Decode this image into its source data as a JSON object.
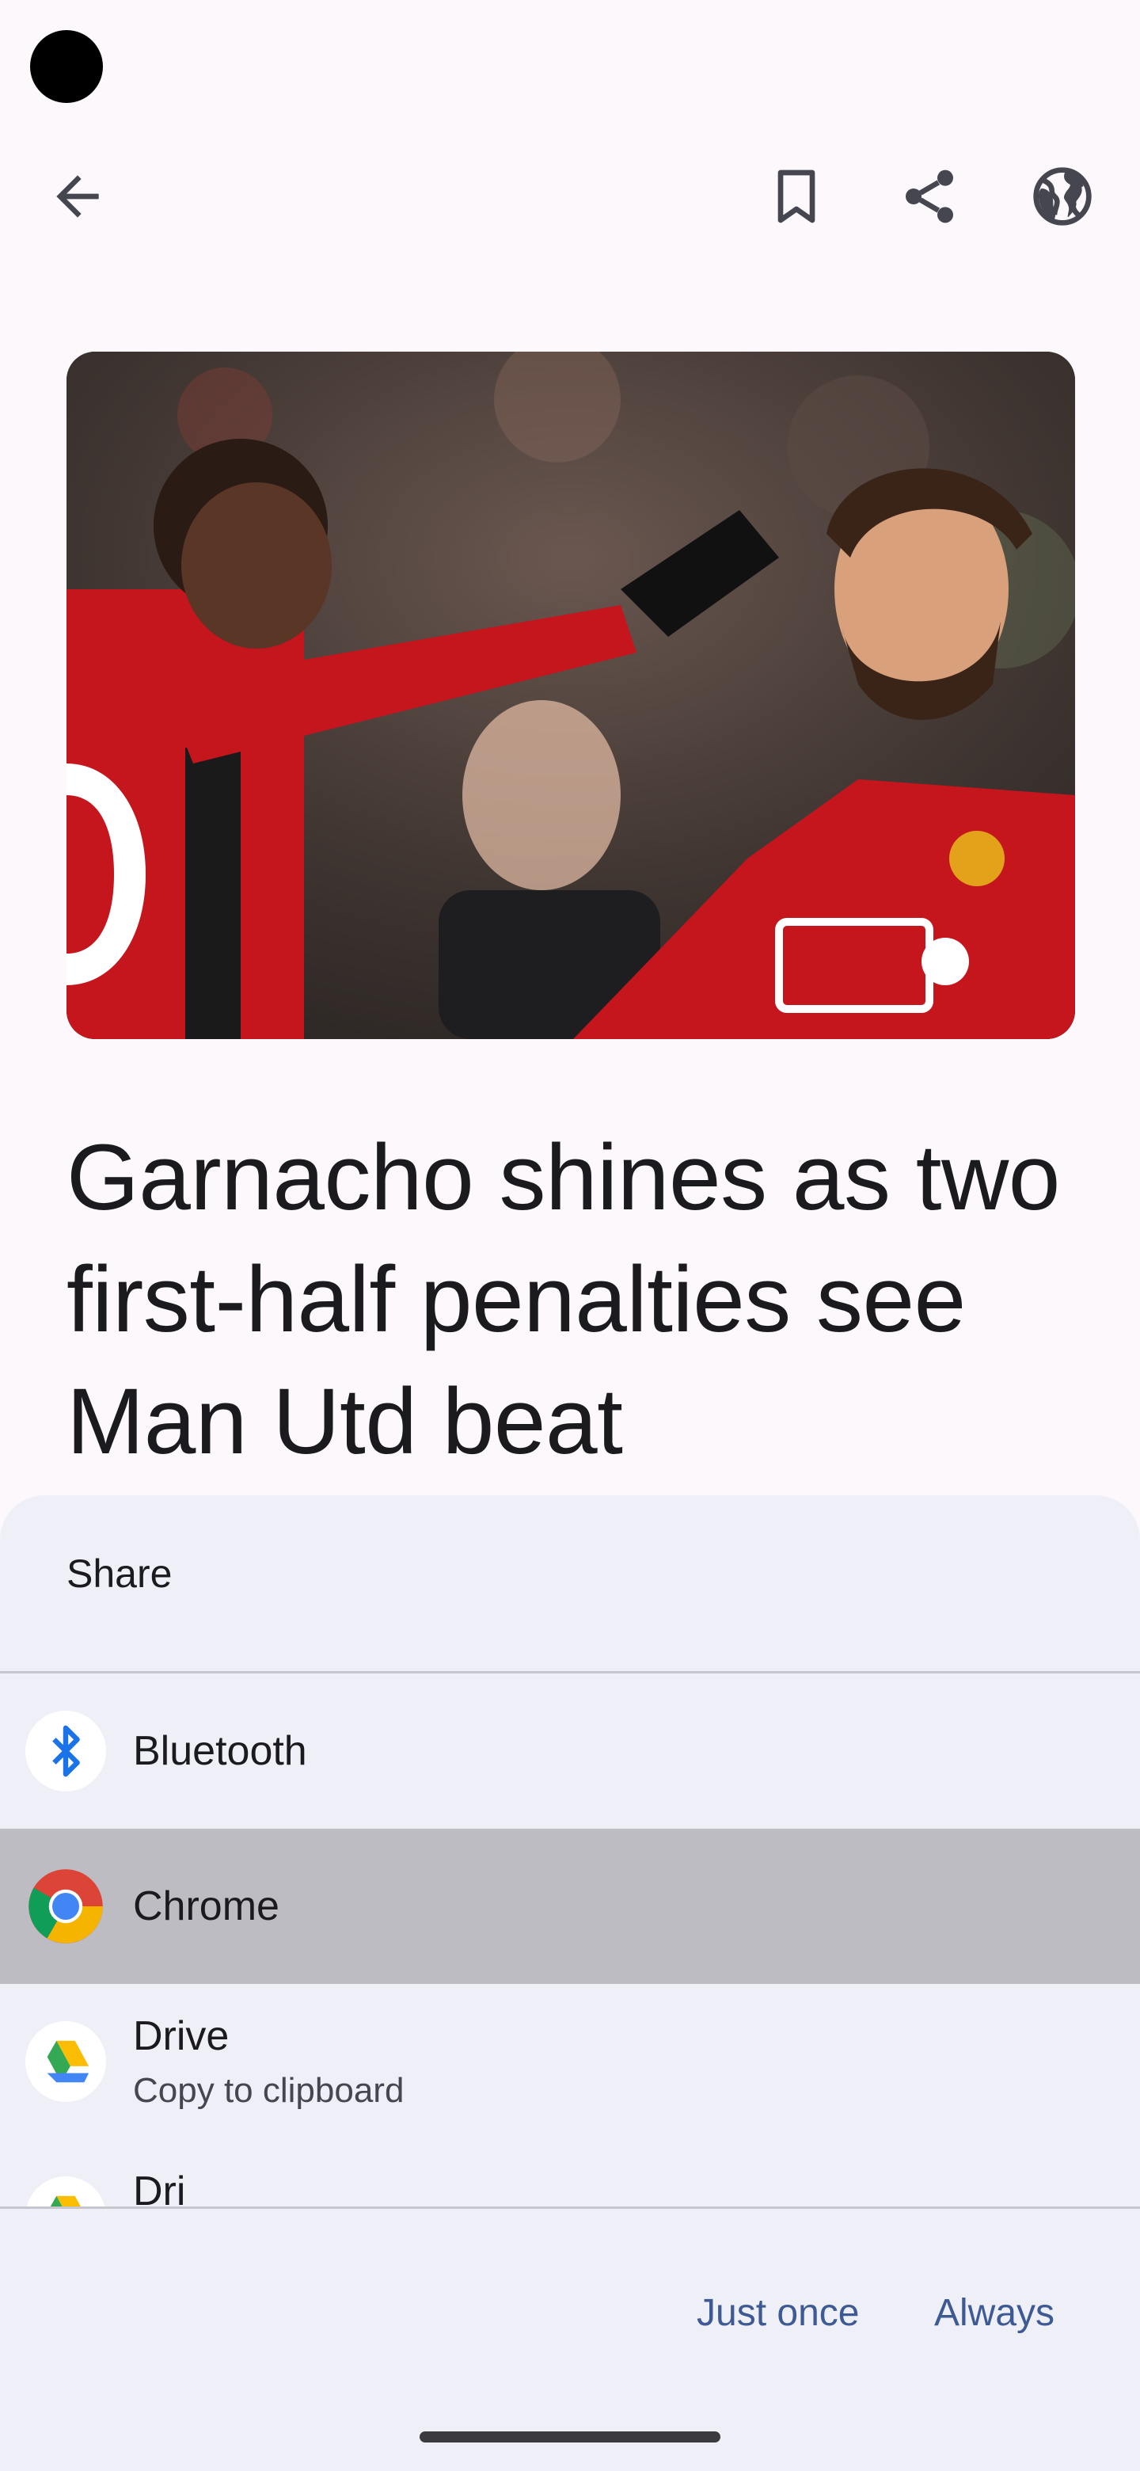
{
  "header": {
    "back_icon": "arrow-left-icon",
    "bookmark_icon": "bookmark-icon",
    "share_icon": "share-icon",
    "globe_icon": "globe-icon"
  },
  "article": {
    "headline": "Garnacho shines as two first-half penalties see Man Utd beat"
  },
  "share_sheet": {
    "title": "Share",
    "items": [
      {
        "label": "Bluetooth",
        "sublabel": "",
        "icon": "bluetooth-icon"
      },
      {
        "label": "Chrome",
        "sublabel": "",
        "icon": "chrome-icon",
        "selected": true
      },
      {
        "label": "Drive",
        "sublabel": "Copy to clipboard",
        "icon": "drive-icon"
      },
      {
        "label": "Dri",
        "sublabel": "",
        "icon": "drive-icon"
      }
    ],
    "actions": {
      "just_once": "Just once",
      "always": "Always"
    }
  },
  "colors": {
    "accent": "#3d5a94",
    "sheet_bg": "#eff0f7",
    "selected_row": "#bcbcc2"
  }
}
